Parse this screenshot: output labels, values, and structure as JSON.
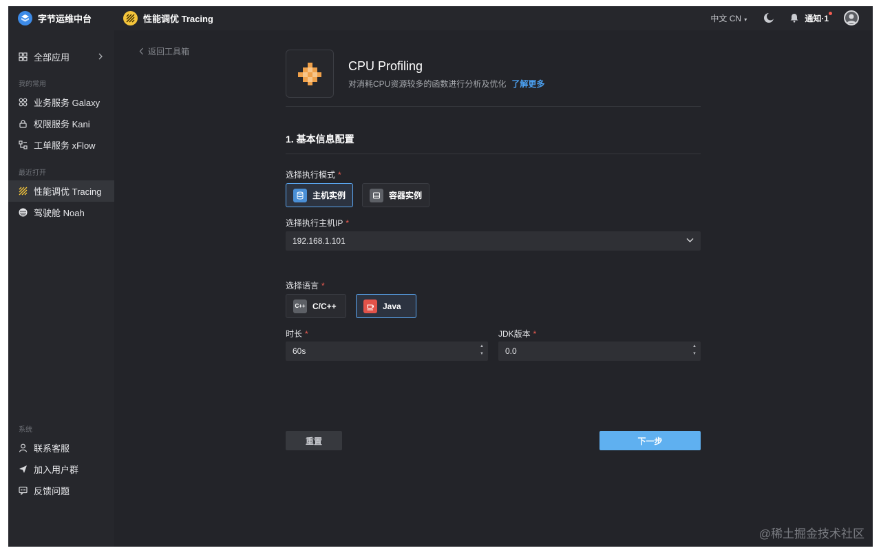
{
  "topbar": {
    "brand_title": "字节运维中台",
    "app_title": "性能调优 Tracing",
    "language": "中文 CN",
    "notify_label": "通知·1"
  },
  "sidebar": {
    "all_apps": "全部应用",
    "group_frequent": "我的常用",
    "frequent": [
      {
        "label": "业务服务 Galaxy",
        "icon": "galaxy-icon"
      },
      {
        "label": "权限服务 Kani",
        "icon": "lock-icon"
      },
      {
        "label": "工单服务 xFlow",
        "icon": "flow-icon"
      }
    ],
    "group_recent": "最近打开",
    "recent": [
      {
        "label": "性能调优 Tracing",
        "icon": "tracing-icon",
        "active": true
      },
      {
        "label": "驾驶舱 Noah",
        "icon": "noah-icon"
      }
    ],
    "group_system": "系统",
    "system": [
      {
        "label": "联系客服",
        "icon": "user-icon"
      },
      {
        "label": "加入用户群",
        "icon": "send-icon"
      },
      {
        "label": "反馈问题",
        "icon": "feedback-icon"
      }
    ]
  },
  "main": {
    "back_label": "返回工具箱",
    "tool_title": "CPU Profiling",
    "tool_desc": "对消耗CPU资源较多的函数进行分析及优化",
    "learn_more": "了解更多",
    "section_title": "1. 基本信息配置",
    "mode_label": "选择执行模式",
    "mode_options": [
      "主机实例",
      "容器实例"
    ],
    "mode_selected": "主机实例",
    "host_label": "选择执行主机IP",
    "host_value": "192.168.1.101",
    "lang_label": "选择语言",
    "lang_options": [
      "C/C++",
      "Java"
    ],
    "lang_selected": "Java",
    "duration_label": "时长",
    "duration_value": "60s",
    "jdk_label": "JDK版本",
    "jdk_value": "0.0",
    "reset_label": "重置",
    "next_label": "下一步"
  },
  "watermark": "@稀土掘金技术社区",
  "colors": {
    "accent": "#5fb0f0",
    "link": "#4ba0f0",
    "required": "#f25d52",
    "background": "#232429"
  }
}
